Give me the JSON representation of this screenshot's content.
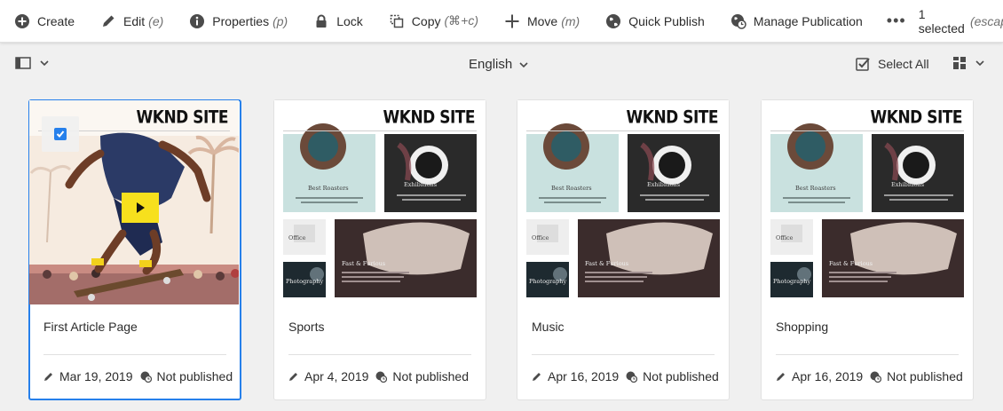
{
  "actionbar": {
    "actions": [
      {
        "label": "Create",
        "shortcut": "",
        "icon": "plus-circle-icon"
      },
      {
        "label": "Edit",
        "shortcut": "(e)",
        "icon": "pencil-icon"
      },
      {
        "label": "Properties",
        "shortcut": "(p)",
        "icon": "info-icon"
      },
      {
        "label": "Lock",
        "shortcut": "",
        "icon": "lock-icon"
      },
      {
        "label": "Copy",
        "shortcut": "(⌘+c)",
        "icon": "copy-icon"
      },
      {
        "label": "Move",
        "shortcut": "(m)",
        "icon": "move-icon"
      },
      {
        "label": "Quick Publish",
        "shortcut": "",
        "icon": "globe-icon"
      },
      {
        "label": "Manage Publication",
        "shortcut": "",
        "icon": "globe-clock-icon"
      }
    ],
    "more": "•••",
    "selection_label": "1 selected",
    "escape_hint": "(escape)"
  },
  "subbar": {
    "language": "English",
    "select_all": "Select All"
  },
  "colors": {
    "accent": "#2680eb",
    "play_button": "#f7e01d"
  },
  "cards": [
    {
      "title": "First Article Page",
      "date": "Mar 19, 2019",
      "status": "Not published",
      "site": "WKND SITE",
      "selected": true
    },
    {
      "title": "Sports",
      "date": "Apr 4, 2019",
      "status": "Not published",
      "site": "WKND SITE",
      "selected": false
    },
    {
      "title": "Music",
      "date": "Apr 16, 2019",
      "status": "Not published",
      "site": "WKND SITE",
      "selected": false
    },
    {
      "title": "Shopping",
      "date": "Apr 16, 2019",
      "status": "Not published",
      "site": "WKND SITE",
      "selected": false
    }
  ],
  "thumbnail_text": {
    "roasters": "Best Roasters",
    "exhibitions": "Exhibitions",
    "office": "Office",
    "fast": "Fast & Furious",
    "photography": "Photography"
  }
}
